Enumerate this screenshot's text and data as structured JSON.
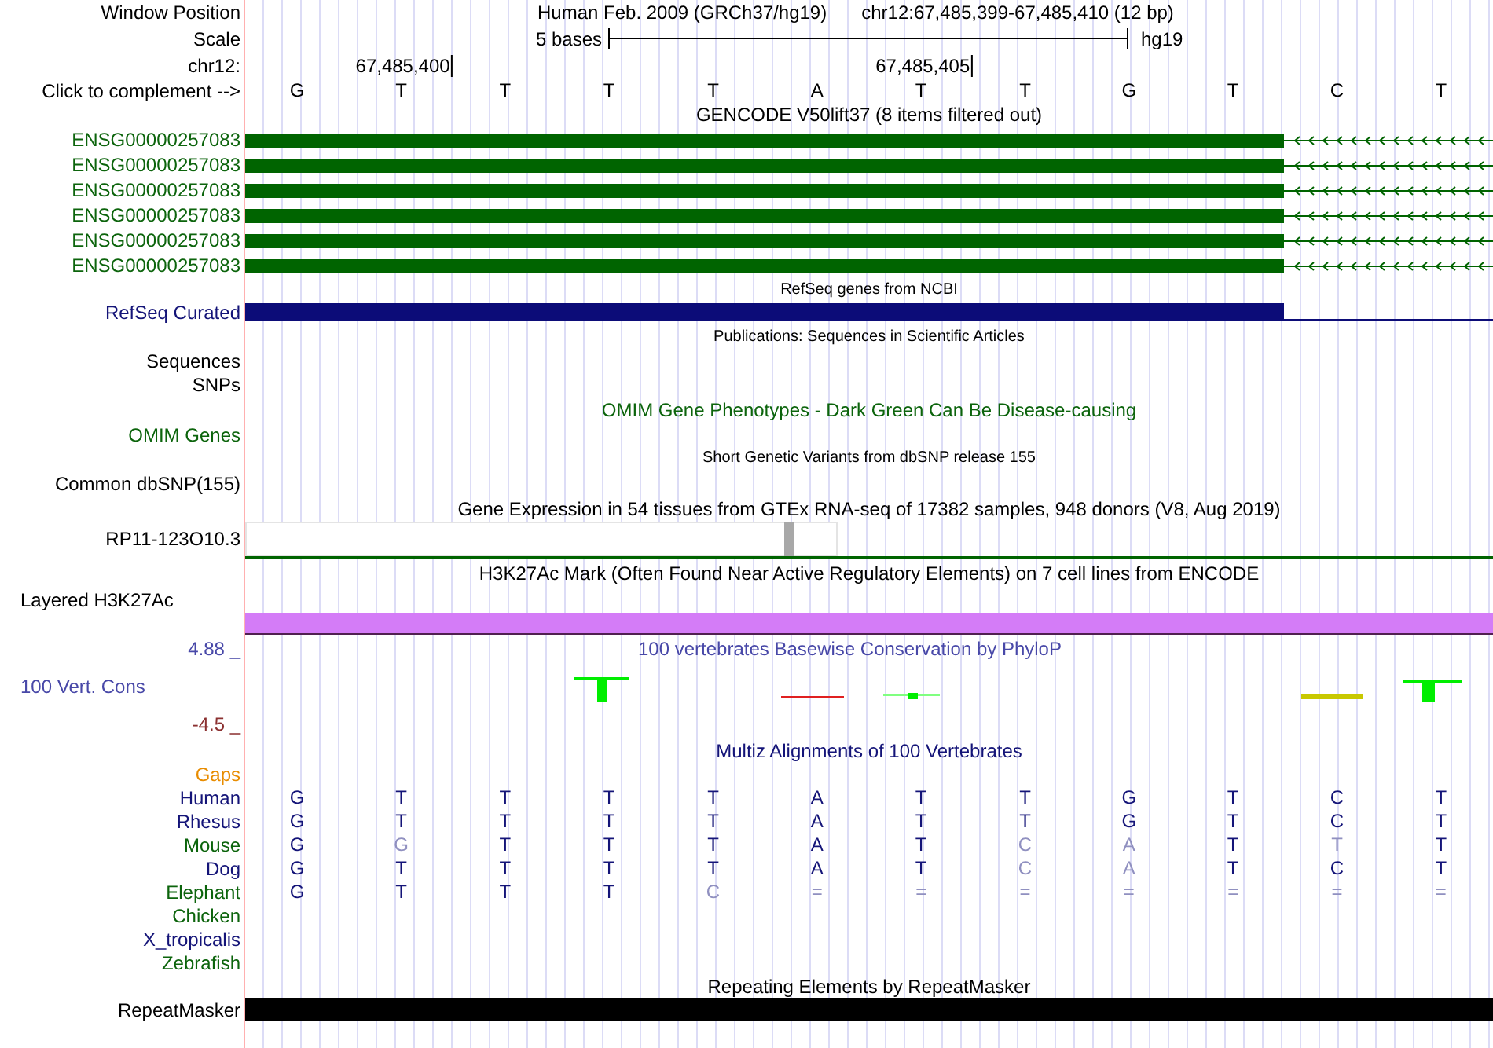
{
  "header": {
    "label": "Window Position",
    "assembly": "Human Feb. 2009 (GRCh37/hg19)",
    "position": "chr12:67,485,399-67,485,410 (12 bp)"
  },
  "scale": {
    "label": "Scale",
    "bar_label": "5 bases",
    "assembly": "hg19"
  },
  "coordinates": {
    "label": "chr12:",
    "ticks": [
      "67,485,400",
      "67,485,405"
    ]
  },
  "sequence": {
    "label": "Click to complement -->",
    "bases": [
      "G",
      "T",
      "T",
      "T",
      "T",
      "A",
      "T",
      "T",
      "G",
      "T",
      "C",
      "T"
    ]
  },
  "tracks": [
    {
      "kind": "genes",
      "title": "GENCODE V50lift37 (8 items filtered out)",
      "items": [
        {
          "label": "ENSG00000257083"
        },
        {
          "label": "ENSG00000257083"
        },
        {
          "label": "ENSG00000257083"
        },
        {
          "label": "ENSG00000257083"
        },
        {
          "label": "ENSG00000257083"
        },
        {
          "label": "ENSG00000257083"
        }
      ]
    },
    {
      "kind": "refseq",
      "title": "RefSeq genes from NCBI",
      "label": "RefSeq Curated"
    },
    {
      "kind": "publications",
      "title": "Publications: Sequences in Scientific Articles",
      "labels": [
        "Sequences",
        "SNPs"
      ]
    },
    {
      "kind": "omim",
      "title": "OMIM Gene Phenotypes - Dark Green Can Be Disease-causing",
      "label": "OMIM Genes"
    },
    {
      "kind": "dbsnp",
      "title": "Short Genetic Variants from dbSNP release 155",
      "label": "Common dbSNP(155)"
    },
    {
      "kind": "gtex",
      "title": "Gene Expression in 54 tissues from GTEx RNA-seq of 17382 samples, 948 donors (V8, Aug 2019)",
      "label": "RP11-123O10.3"
    },
    {
      "kind": "layered",
      "title": "H3K27Ac Mark (Often Found Near Active Regulatory Elements) on 7 cell lines from ENCODE",
      "label": "Layered H3K27Ac"
    },
    {
      "kind": "phylop",
      "title": "100 vertebrates Basewise Conservation by PhyloP",
      "label": "100 Vert. Cons",
      "max": "4.88 _",
      "min": "-4.5 _"
    },
    {
      "kind": "multiz",
      "title": "Multiz Alignments of 100 Vertebrates",
      "gaps_label": "Gaps",
      "species": [
        {
          "name": "Human",
          "color": "#141478",
          "bases": [
            {
              "base": "G",
              "dim": false
            },
            {
              "base": "T",
              "dim": false
            },
            {
              "base": "T",
              "dim": false
            },
            {
              "base": "T",
              "dim": false
            },
            {
              "base": "T",
              "dim": false
            },
            {
              "base": "A",
              "dim": false
            },
            {
              "base": "T",
              "dim": false
            },
            {
              "base": "T",
              "dim": false
            },
            {
              "base": "G",
              "dim": false
            },
            {
              "base": "T",
              "dim": false
            },
            {
              "base": "C",
              "dim": false
            },
            {
              "base": "T",
              "dim": false
            }
          ]
        },
        {
          "name": "Rhesus",
          "color": "#141478",
          "bases": [
            {
              "base": "G",
              "dim": false
            },
            {
              "base": "T",
              "dim": false
            },
            {
              "base": "T",
              "dim": false
            },
            {
              "base": "T",
              "dim": false
            },
            {
              "base": "T",
              "dim": false
            },
            {
              "base": "A",
              "dim": false
            },
            {
              "base": "T",
              "dim": false
            },
            {
              "base": "T",
              "dim": false
            },
            {
              "base": "G",
              "dim": false
            },
            {
              "base": "T",
              "dim": false
            },
            {
              "base": "C",
              "dim": false
            },
            {
              "base": "T",
              "dim": false
            }
          ]
        },
        {
          "name": "Mouse",
          "color": "#0c640c",
          "bases": [
            {
              "base": "G",
              "dim": false
            },
            {
              "base": "G",
              "dim": true
            },
            {
              "base": "T",
              "dim": false
            },
            {
              "base": "T",
              "dim": false
            },
            {
              "base": "T",
              "dim": false
            },
            {
              "base": "A",
              "dim": false
            },
            {
              "base": "T",
              "dim": false
            },
            {
              "base": "C",
              "dim": true
            },
            {
              "base": "A",
              "dim": true
            },
            {
              "base": "T",
              "dim": false
            },
            {
              "base": "T",
              "dim": true
            },
            {
              "base": "T",
              "dim": false
            }
          ]
        },
        {
          "name": "Dog",
          "color": "#141478",
          "bases": [
            {
              "base": "G",
              "dim": false
            },
            {
              "base": "T",
              "dim": false
            },
            {
              "base": "T",
              "dim": false
            },
            {
              "base": "T",
              "dim": false
            },
            {
              "base": "T",
              "dim": false
            },
            {
              "base": "A",
              "dim": false
            },
            {
              "base": "T",
              "dim": false
            },
            {
              "base": "C",
              "dim": true
            },
            {
              "base": "A",
              "dim": true
            },
            {
              "base": "T",
              "dim": false
            },
            {
              "base": "C",
              "dim": false
            },
            {
              "base": "T",
              "dim": false
            }
          ]
        },
        {
          "name": "Elephant",
          "color": "#0c640c",
          "bases": [
            {
              "base": "G",
              "dim": false
            },
            {
              "base": "T",
              "dim": false
            },
            {
              "base": "T",
              "dim": false
            },
            {
              "base": "T",
              "dim": false
            },
            {
              "base": "C",
              "dim": true
            },
            {
              "base": "=",
              "dim": true
            },
            {
              "base": "=",
              "dim": true
            },
            {
              "base": "=",
              "dim": true
            },
            {
              "base": "=",
              "dim": true
            },
            {
              "base": "=",
              "dim": true
            },
            {
              "base": "=",
              "dim": true
            },
            {
              "base": "=",
              "dim": true
            }
          ]
        },
        {
          "name": "Chicken",
          "color": "#0c640c"
        },
        {
          "name": "X_tropicalis",
          "color": "#141478"
        },
        {
          "name": "Zebrafish",
          "color": "#0c640c"
        }
      ]
    },
    {
      "kind": "repeatmasker",
      "title": "Repeating Elements by RepeatMasker",
      "label": "RepeatMasker"
    }
  ]
}
